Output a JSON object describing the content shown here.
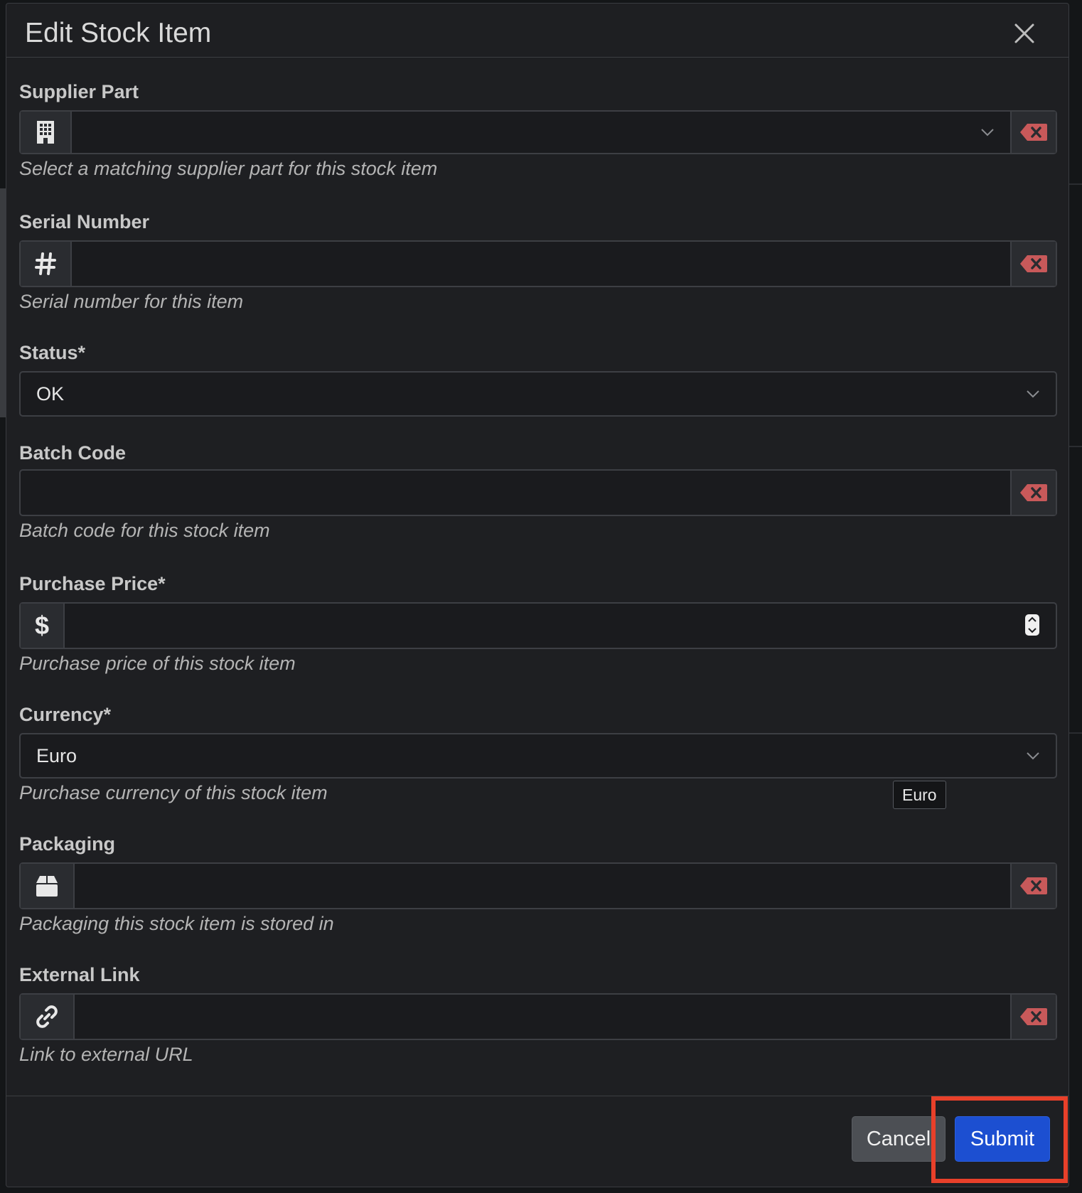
{
  "dialog": {
    "title": "Edit Stock Item"
  },
  "fields": {
    "supplier_part": {
      "label": "Supplier Part",
      "value": "",
      "help": "Select a matching supplier part for this stock item"
    },
    "serial_number": {
      "label": "Serial Number",
      "value": "",
      "help": "Serial number for this item"
    },
    "status": {
      "label": "Status*",
      "value": "OK"
    },
    "batch_code": {
      "label": "Batch Code",
      "value": "",
      "help": "Batch code for this stock item"
    },
    "purchase_price": {
      "label": "Purchase Price*",
      "value": "",
      "help": "Purchase price of this stock item"
    },
    "currency": {
      "label": "Currency*",
      "value": "Euro",
      "help": "Purchase currency of this stock item",
      "tooltip": "Euro"
    },
    "packaging": {
      "label": "Packaging",
      "value": "",
      "help": "Packaging this stock item is stored in"
    },
    "external_link": {
      "label": "External Link",
      "value": "",
      "help": "Link to external URL"
    }
  },
  "footer": {
    "cancel_label": "Cancel",
    "submit_label": "Submit"
  },
  "icons": {
    "supplier_part": "building-icon",
    "serial_number": "hash-icon",
    "purchase_price": "dollar-icon",
    "packaging": "box-icon",
    "external_link": "link-icon",
    "clear": "backspace-x-icon",
    "close": "close-icon"
  },
  "colors": {
    "clear_icon": "#c8595a",
    "submit_bg": "#1c4fd1",
    "highlight": "#e8402a"
  }
}
